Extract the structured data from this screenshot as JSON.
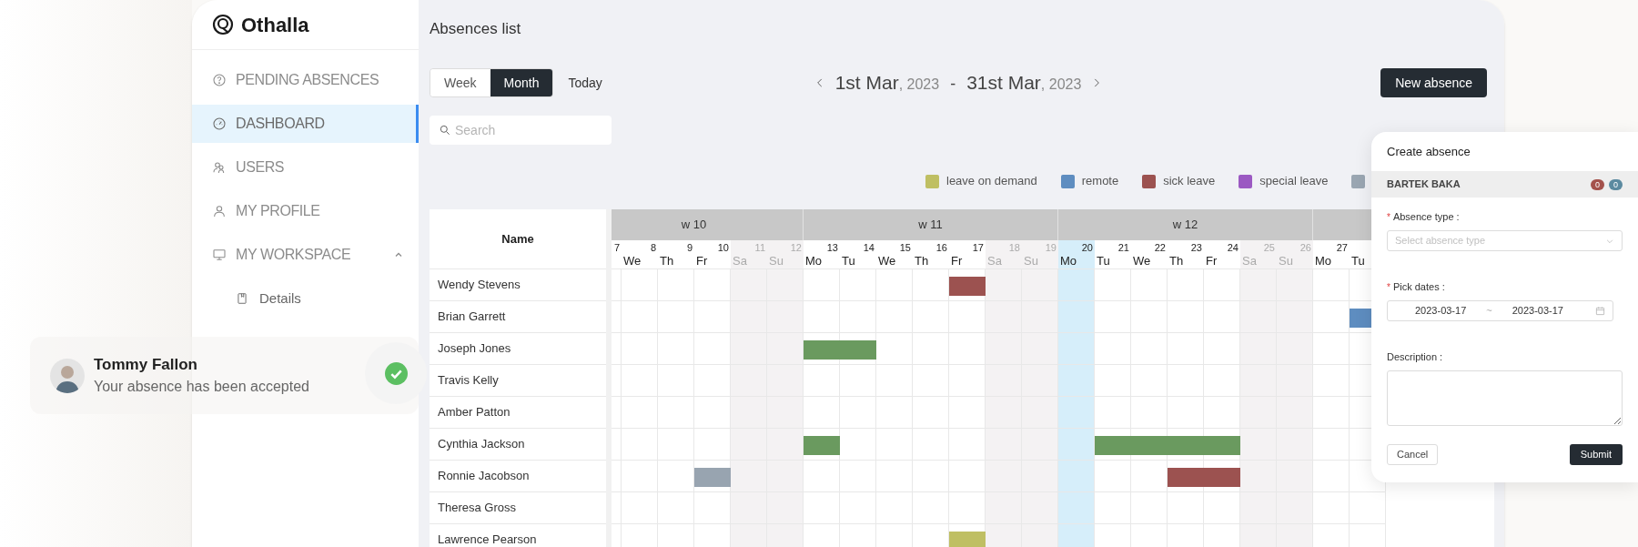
{
  "sidebar": {
    "logo": "Othalla",
    "items": [
      {
        "label": "PENDING ABSENCES",
        "selected": false
      },
      {
        "label": "DASHBOARD",
        "selected": true
      },
      {
        "label": "USERS",
        "selected": false
      },
      {
        "label": "MY PROFILE",
        "selected": false
      },
      {
        "label": "MY WORKSPACE",
        "selected": false,
        "expanded": true,
        "children": [
          {
            "label": "Details",
            "selected": false
          }
        ]
      }
    ]
  },
  "toast": {
    "name": "Tommy Fallon",
    "message": "Your absence has been accepted"
  },
  "page_title": "Absences list",
  "view_toggle": [
    {
      "label": "Week",
      "selected": false
    },
    {
      "label": "Month",
      "selected": true
    }
  ],
  "today_button": "Today",
  "date_range": {
    "start": "1st Mar",
    "start_year": ", 2023",
    "separator": "-",
    "end": "31st Mar",
    "end_year": ", 2023"
  },
  "new_absence_button": "New absence",
  "search": {
    "placeholder": "Search"
  },
  "legend": [
    {
      "label": "leave on demand",
      "color": "#bfbf63"
    },
    {
      "label": "remote",
      "color": "#5e8dc0"
    },
    {
      "label": "sick leave",
      "color": "#9c5250"
    },
    {
      "label": "special leave",
      "color": "#9b59c2"
    },
    {
      "color": "#9aa6b2"
    }
  ],
  "calendar": {
    "name_header": "Name",
    "weeks": [
      {
        "label": "w 10",
        "days": [
          {
            "day": "7",
            "weekend": false,
            "today": false
          },
          {
            "day": "8",
            "weekday": "We",
            "weekend": false,
            "today": false
          },
          {
            "day": "9",
            "weekday": "Th",
            "weekend": false,
            "today": false
          },
          {
            "day": "10",
            "weekday": "Fr",
            "weekend": false,
            "today": false
          },
          {
            "day": "11",
            "weekday": "Sa",
            "weekend": true,
            "today": false
          },
          {
            "day": "12",
            "weekday": "Su",
            "weekend": true,
            "today": false
          }
        ]
      },
      {
        "label": "w 11",
        "days": [
          {
            "day": "13",
            "weekday": "Mo",
            "weekend": false,
            "today": false
          },
          {
            "day": "14",
            "weekday": "Tu",
            "weekend": false,
            "today": false
          },
          {
            "day": "15",
            "weekday": "We",
            "weekend": false,
            "today": false
          },
          {
            "day": "16",
            "weekday": "Th",
            "weekend": false,
            "today": false
          },
          {
            "day": "17",
            "weekday": "Fr",
            "weekend": false,
            "today": false
          },
          {
            "day": "18",
            "weekday": "Sa",
            "weekend": true,
            "today": false
          },
          {
            "day": "19",
            "weekday": "Su",
            "weekend": true,
            "today": false
          }
        ]
      },
      {
        "label": "w 12",
        "days": [
          {
            "day": "20",
            "weekday": "Mo",
            "weekend": false,
            "today": true
          },
          {
            "day": "21",
            "weekday": "Tu",
            "weekend": false,
            "today": false
          },
          {
            "day": "22",
            "weekday": "We",
            "weekend": false,
            "today": false
          },
          {
            "day": "23",
            "weekday": "Th",
            "weekend": false,
            "today": false
          },
          {
            "day": "24",
            "weekday": "Fr",
            "weekend": false,
            "today": false
          },
          {
            "day": "25",
            "weekday": "Sa",
            "weekend": true,
            "today": false
          },
          {
            "day": "26",
            "weekday": "Su",
            "weekend": true,
            "today": false
          }
        ]
      },
      {
        "days": [
          {
            "day": "27",
            "weekday": "Mo",
            "weekend": false,
            "today": false
          },
          {
            "weekday": "Tu",
            "weekend": false,
            "today": false
          }
        ]
      }
    ],
    "rows": [
      {
        "name": "Wendy Stevens",
        "cells": [
          {
            "absent": false
          },
          {
            "absent": false
          },
          {
            "absent": false
          },
          {
            "absent": false
          },
          {
            "absent": false
          },
          {
            "absent": false
          },
          {
            "absent": false
          },
          {
            "absent": false
          },
          {
            "absent": false
          },
          {
            "absent": false
          },
          {
            "absent": true,
            "color": "#9c5250"
          },
          {
            "absent": false
          },
          {
            "absent": false
          },
          {
            "absent": false
          },
          {
            "absent": false
          },
          {
            "absent": false
          },
          {
            "absent": false
          },
          {
            "absent": false
          },
          {
            "absent": false
          },
          {
            "absent": false
          },
          {
            "absent": false
          },
          {
            "absent": false
          }
        ]
      },
      {
        "name": "Brian Garrett",
        "cells": [
          {
            "absent": false
          },
          {
            "absent": false
          },
          {
            "absent": false
          },
          {
            "absent": false
          },
          {
            "absent": false
          },
          {
            "absent": false
          },
          {
            "absent": false
          },
          {
            "absent": false
          },
          {
            "absent": false
          },
          {
            "absent": false
          },
          {
            "absent": false
          },
          {
            "absent": false
          },
          {
            "absent": false
          },
          {
            "absent": false
          },
          {
            "absent": false
          },
          {
            "absent": false
          },
          {
            "absent": false
          },
          {
            "absent": false
          },
          {
            "absent": false
          },
          {
            "absent": false
          },
          {
            "absent": false
          },
          {
            "absent": true,
            "color": "#5e8dc0"
          }
        ]
      },
      {
        "name": "Joseph Jones",
        "cells": [
          {
            "absent": false
          },
          {
            "absent": false
          },
          {
            "absent": false
          },
          {
            "absent": false
          },
          {
            "absent": false
          },
          {
            "absent": false
          },
          {
            "absent": true,
            "color": "#6a9a5f"
          },
          {
            "absent": true,
            "color": "#6a9a5f"
          },
          {
            "absent": false
          },
          {
            "absent": false
          },
          {
            "absent": false
          },
          {
            "absent": false
          },
          {
            "absent": false
          },
          {
            "absent": false
          },
          {
            "absent": false
          },
          {
            "absent": false
          },
          {
            "absent": false
          },
          {
            "absent": false
          },
          {
            "absent": false
          },
          {
            "absent": false
          },
          {
            "absent": false
          },
          {
            "absent": false
          }
        ]
      },
      {
        "name": "Travis Kelly",
        "cells": [
          {
            "absent": false
          },
          {
            "absent": false
          },
          {
            "absent": false
          },
          {
            "absent": false
          },
          {
            "absent": false
          },
          {
            "absent": false
          },
          {
            "absent": false
          },
          {
            "absent": false
          },
          {
            "absent": false
          },
          {
            "absent": false
          },
          {
            "absent": false
          },
          {
            "absent": false
          },
          {
            "absent": false
          },
          {
            "absent": false
          },
          {
            "absent": false
          },
          {
            "absent": false
          },
          {
            "absent": false
          },
          {
            "absent": false
          },
          {
            "absent": false
          },
          {
            "absent": false
          },
          {
            "absent": false
          },
          {
            "absent": false
          }
        ]
      },
      {
        "name": "Amber Patton",
        "cells": [
          {
            "absent": false
          },
          {
            "absent": false
          },
          {
            "absent": false
          },
          {
            "absent": false
          },
          {
            "absent": false
          },
          {
            "absent": false
          },
          {
            "absent": false
          },
          {
            "absent": false
          },
          {
            "absent": false
          },
          {
            "absent": false
          },
          {
            "absent": false
          },
          {
            "absent": false
          },
          {
            "absent": false
          },
          {
            "absent": false
          },
          {
            "absent": false
          },
          {
            "absent": false
          },
          {
            "absent": false
          },
          {
            "absent": false
          },
          {
            "absent": false
          },
          {
            "absent": false
          },
          {
            "absent": false
          },
          {
            "absent": false
          }
        ]
      },
      {
        "name": "Cynthia Jackson",
        "cells": [
          {
            "absent": false
          },
          {
            "absent": false
          },
          {
            "absent": false
          },
          {
            "absent": false
          },
          {
            "absent": false
          },
          {
            "absent": false
          },
          {
            "absent": true,
            "color": "#6a9a5f"
          },
          {
            "absent": false
          },
          {
            "absent": false
          },
          {
            "absent": false
          },
          {
            "absent": false
          },
          {
            "absent": false
          },
          {
            "absent": false
          },
          {
            "absent": false
          },
          {
            "absent": true,
            "color": "#6a9a5f"
          },
          {
            "absent": true,
            "color": "#6a9a5f"
          },
          {
            "absent": true,
            "color": "#6a9a5f"
          },
          {
            "absent": true,
            "color": "#6a9a5f"
          },
          {
            "absent": false
          },
          {
            "absent": false
          },
          {
            "absent": false
          },
          {
            "absent": false
          }
        ]
      },
      {
        "name": "Ronnie Jacobson",
        "cells": [
          {
            "absent": false
          },
          {
            "absent": false
          },
          {
            "absent": false
          },
          {
            "absent": true,
            "color": "#98a4b0"
          },
          {
            "absent": false
          },
          {
            "absent": false
          },
          {
            "absent": false
          },
          {
            "absent": false
          },
          {
            "absent": false
          },
          {
            "absent": false
          },
          {
            "absent": false
          },
          {
            "absent": false
          },
          {
            "absent": false
          },
          {
            "absent": false
          },
          {
            "absent": false
          },
          {
            "absent": false
          },
          {
            "absent": true,
            "color": "#9c5250"
          },
          {
            "absent": true,
            "color": "#9c5250"
          },
          {
            "absent": false
          },
          {
            "absent": false
          },
          {
            "absent": false
          },
          {
            "absent": false
          }
        ]
      },
      {
        "name": "Theresa Gross",
        "cells": [
          {
            "absent": false
          },
          {
            "absent": false
          },
          {
            "absent": false
          },
          {
            "absent": false
          },
          {
            "absent": false
          },
          {
            "absent": false
          },
          {
            "absent": false
          },
          {
            "absent": false
          },
          {
            "absent": false
          },
          {
            "absent": false
          },
          {
            "absent": false
          },
          {
            "absent": false
          },
          {
            "absent": false
          },
          {
            "absent": false
          },
          {
            "absent": false
          },
          {
            "absent": false
          },
          {
            "absent": false
          },
          {
            "absent": false
          },
          {
            "absent": false
          },
          {
            "absent": false
          },
          {
            "absent": false
          },
          {
            "absent": false
          }
        ]
      },
      {
        "name": "Lawrence Pearson",
        "cells": [
          {
            "absent": false
          },
          {
            "absent": false
          },
          {
            "absent": false
          },
          {
            "absent": false
          },
          {
            "absent": false
          },
          {
            "absent": false
          },
          {
            "absent": false
          },
          {
            "absent": false
          },
          {
            "absent": false
          },
          {
            "absent": false
          },
          {
            "absent": true,
            "color": "#bfbf63"
          },
          {
            "absent": false
          },
          {
            "absent": false
          },
          {
            "absent": false
          },
          {
            "absent": false
          },
          {
            "absent": false
          },
          {
            "absent": false
          },
          {
            "absent": false
          },
          {
            "absent": false
          },
          {
            "absent": false
          },
          {
            "absent": false
          },
          {
            "absent": false
          }
        ]
      }
    ]
  },
  "panel": {
    "title": "Create absence",
    "user": "BARTEK BAKA",
    "badges": [
      {
        "text": "0",
        "color": "#a4524c"
      },
      {
        "text": "0",
        "color": "#5b8aa0"
      }
    ],
    "fields": [
      {
        "kind": "select",
        "required_mark": "*",
        "label": "Absence type :",
        "placeholder": "Select absence type"
      },
      {
        "kind": "daterange",
        "required_mark": "*",
        "label": "Pick dates :",
        "start": "2023-03-17",
        "separator": "~",
        "end": "2023-03-17"
      },
      {
        "kind": "textarea",
        "label": "Description :"
      }
    ],
    "cancel": "Cancel",
    "submit": "Submit"
  }
}
